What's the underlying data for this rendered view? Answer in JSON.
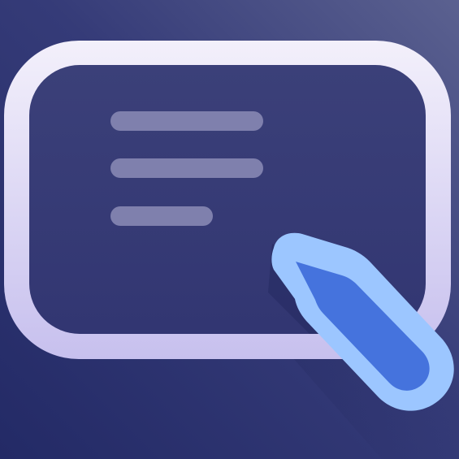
{
  "app_icon": {
    "subject": "text-box-with-pointer-cursor",
    "text_lines_count": 3,
    "colors": {
      "background_top_right": "#5b6190",
      "background_mid": "#353b78",
      "background_bottom_left": "#232a66",
      "frame_top": "#f3f0fb",
      "frame_bottom": "#c7c0ee",
      "panel_fill": "#3b4079",
      "panel_fill_bottom": "#323672",
      "text_line": "#7f80ad",
      "cursor_outline": "#9cc6ff",
      "cursor_fill": "#4573dd",
      "shadow": "#1d2357"
    }
  }
}
